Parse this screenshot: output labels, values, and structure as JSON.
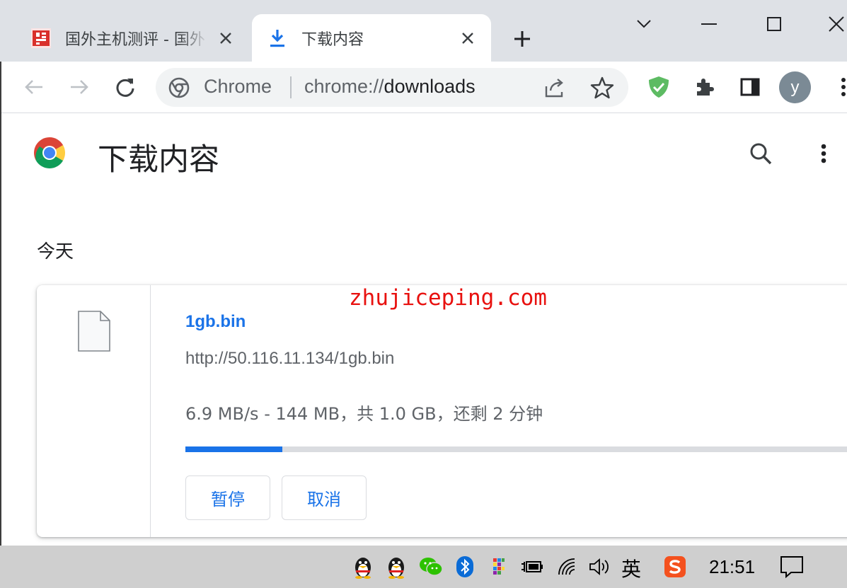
{
  "tabs": [
    {
      "title": "国外主机测评 - 国外",
      "active": false,
      "favicon": "site-favicon"
    },
    {
      "title": "下载内容",
      "active": true,
      "favicon": "download-icon"
    }
  ],
  "toolbar": {
    "omnibox_chip": "Chrome",
    "url_scheme": "chrome://",
    "url_host": "downloads",
    "avatar_letter": "y"
  },
  "page": {
    "title": "下载内容",
    "section_date": "今天"
  },
  "download": {
    "file_name": "1gb.bin",
    "url": "http://50.116.11.134/1gb.bin",
    "status": "6.9 MB/s - 144 MB，共 1.0 GB，还剩 2 分钟",
    "progress_fraction": 0.144,
    "pause_label": "暂停",
    "cancel_label": "取消"
  },
  "watermark": "zhujiceping.com",
  "taskbar": {
    "ime_label": "英",
    "time": "21:51"
  },
  "colors": {
    "accent": "#1a73e8",
    "tabstrip": "#dee1e6",
    "watermark": "#e8110f"
  }
}
